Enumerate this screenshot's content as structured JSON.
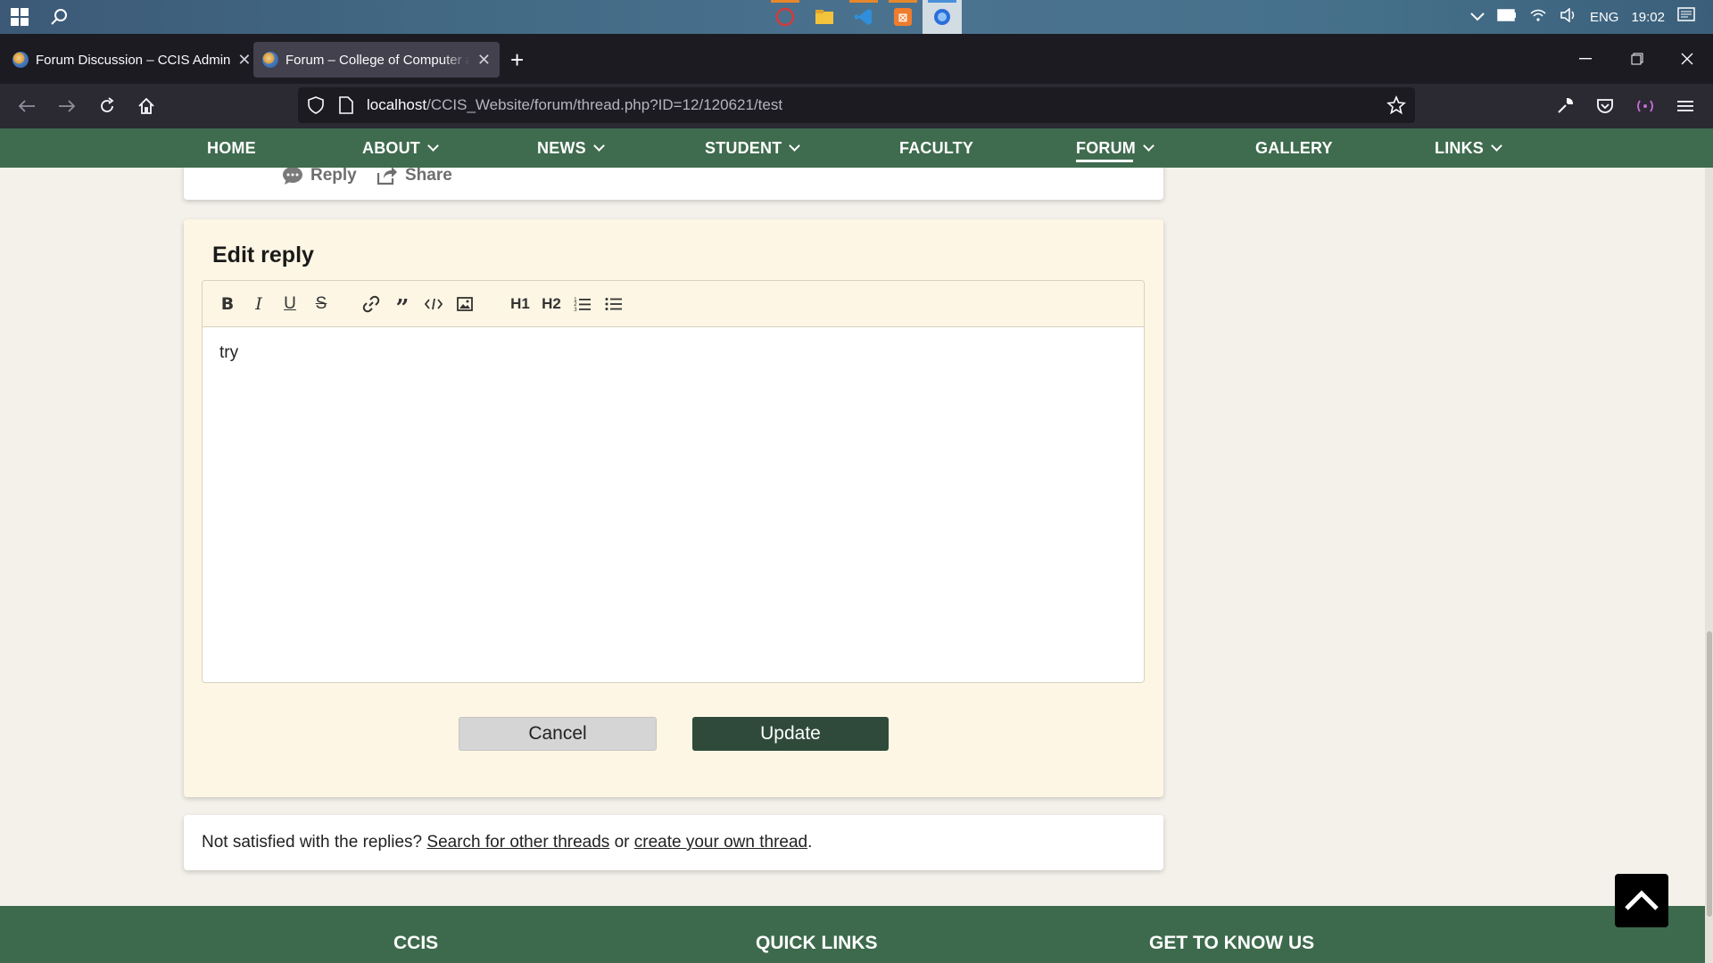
{
  "taskbar": {
    "tray": {
      "lang": "ENG",
      "time": "19:02"
    }
  },
  "browser": {
    "tabs": [
      {
        "title": "Forum Discussion – CCIS Admin"
      },
      {
        "title": "Forum – College of Computer a"
      }
    ],
    "url": {
      "host": "localhost",
      "path": "/CCIS_Website/forum/thread.php?ID=12/120621/test"
    }
  },
  "sitenav": {
    "items": [
      {
        "label": "HOME"
      },
      {
        "label": "ABOUT"
      },
      {
        "label": "NEWS"
      },
      {
        "label": "STUDENT"
      },
      {
        "label": "FACULTY"
      },
      {
        "label": "FORUM"
      },
      {
        "label": "GALLERY"
      },
      {
        "label": "LINKS"
      }
    ]
  },
  "post_actions": {
    "reply": "Reply",
    "share": "Share"
  },
  "edit_reply": {
    "title": "Edit reply",
    "toolbar": {
      "h1": "H1",
      "h2": "H2"
    },
    "content": "try",
    "cancel_label": "Cancel",
    "update_label": "Update"
  },
  "note": {
    "prefix": "Not satisfied with the replies?",
    "link1": "Search for other threads",
    "middle": "or",
    "link2": "create your own thread",
    "suffix": "."
  },
  "footer": {
    "columns": [
      {
        "title": "CCIS"
      },
      {
        "title": "QUICK LINKS"
      },
      {
        "title": "GET TO KNOW US"
      }
    ]
  },
  "colors": {
    "nav_green": "#3f6b4e",
    "update_button": "#2f4a3a",
    "edit_bg": "#fdf6e4"
  }
}
